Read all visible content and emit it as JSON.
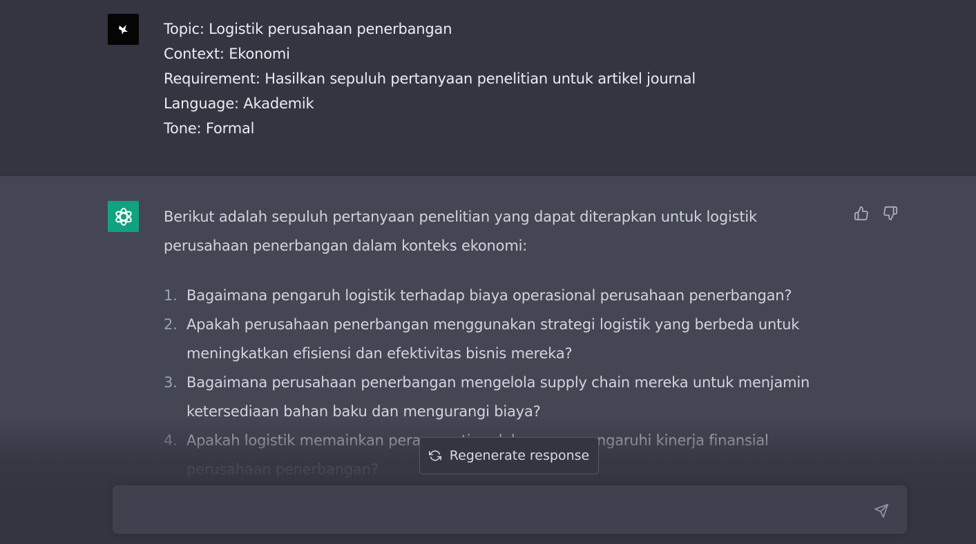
{
  "user_message": {
    "lines": [
      "Topic: Logistik perusahaan penerbangan",
      "Context: Ekonomi",
      "Requirement: Hasilkan sepuluh pertanyaan penelitian untuk artikel journal",
      "Language: Akademik",
      "Tone: Formal"
    ]
  },
  "assistant_message": {
    "intro": "Berikut adalah sepuluh pertanyaan penelitian yang dapat diterapkan untuk logistik perusahaan penerbangan dalam konteks ekonomi:",
    "questions": [
      {
        "num": "1.",
        "text": "Bagaimana pengaruh logistik terhadap biaya operasional perusahaan penerbangan?"
      },
      {
        "num": "2.",
        "text": "Apakah perusahaan penerbangan menggunakan strategi logistik yang berbeda untuk meningkatkan efisiensi dan efektivitas bisnis mereka?"
      },
      {
        "num": "3.",
        "text": "Bagaimana perusahaan penerbangan mengelola supply chain mereka untuk menjamin ketersediaan bahan baku dan mengurangi biaya?"
      },
      {
        "num": "4.",
        "text": "Apakah logistik memainkan peran penting dalam mempengaruhi kinerja finansial perusahaan penerbangan?"
      }
    ]
  },
  "regenerate": {
    "label": "Regenerate response"
  },
  "composer": {
    "placeholder": "",
    "value": ""
  },
  "icons": {
    "user_avatar": "user-avatar-icon",
    "bot_avatar": "openai-logo-icon",
    "thumb_up": "thumbs-up-icon",
    "thumb_down": "thumbs-down-icon",
    "regenerate": "refresh-icon",
    "send": "send-icon"
  },
  "colors": {
    "user_bg": "#343541",
    "assistant_bg": "#444654",
    "bot_avatar_bg": "#10a37f",
    "text": "#d1d5db"
  }
}
